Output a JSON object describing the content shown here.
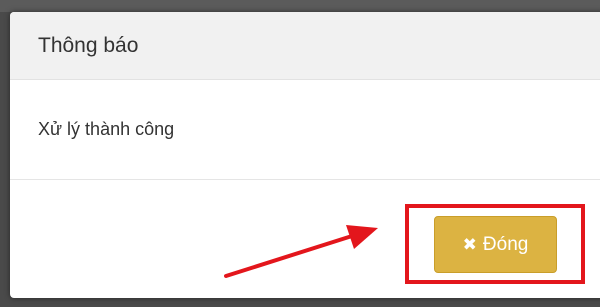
{
  "modal": {
    "title": "Thông báo",
    "message": "Xử lý thành công",
    "close_label": "Đóng",
    "close_icon": "close-icon"
  },
  "colors": {
    "button": "#dcb342",
    "highlight": "#e3161c",
    "header_bg": "#f1f1f1"
  }
}
